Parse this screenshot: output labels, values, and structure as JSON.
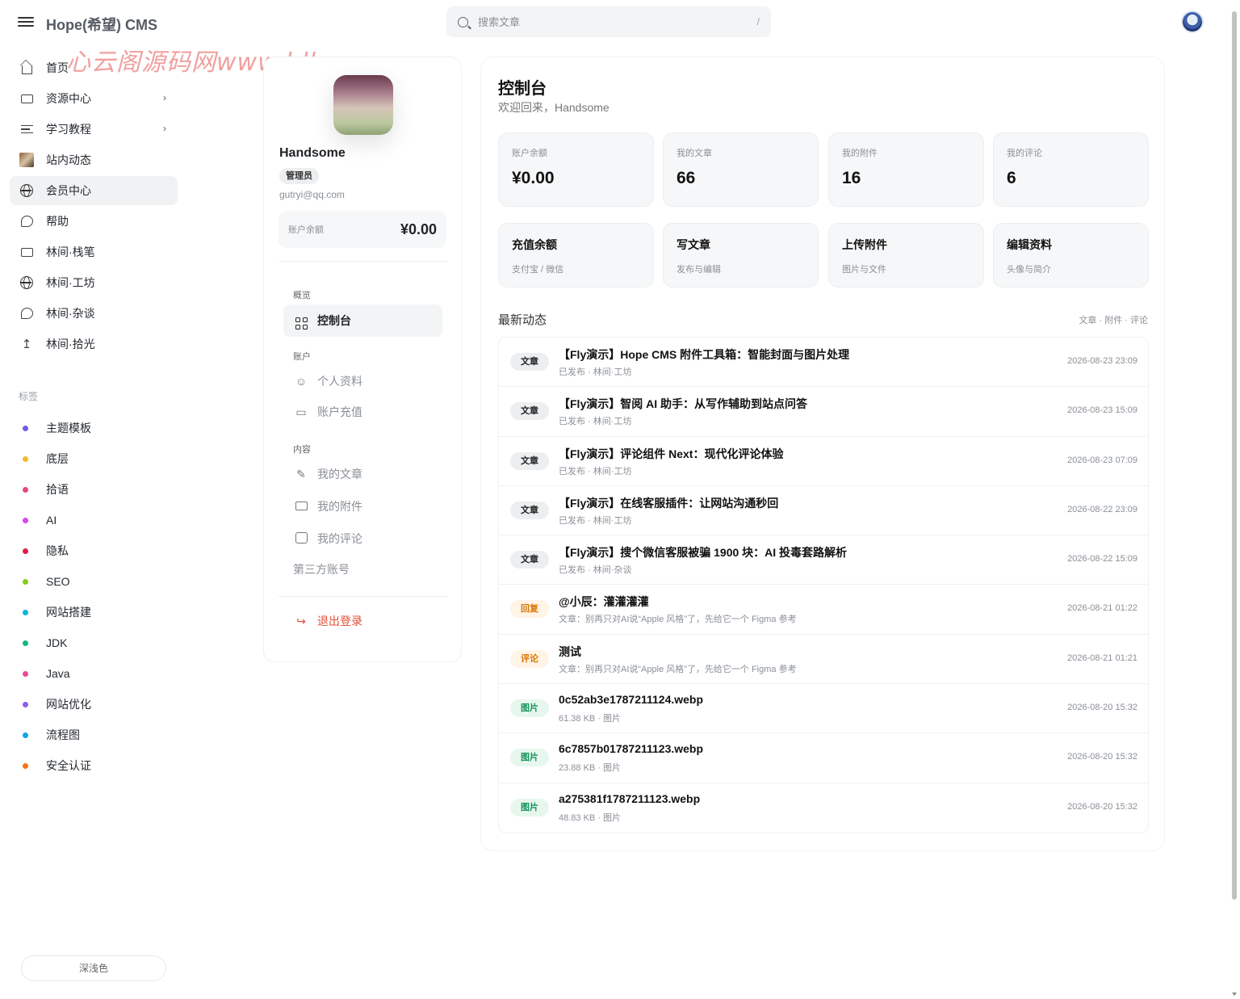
{
  "header": {
    "brand": "Hope(希望) CMS",
    "search_placeholder": "搜索文章",
    "search_shortcut": "/",
    "watermark": "心云阁源码网www.bllo.cn"
  },
  "nav": {
    "items": [
      {
        "label": "首页",
        "icon": "home-icon"
      },
      {
        "label": "资源中心",
        "icon": "folder-icon",
        "has_children": true
      },
      {
        "label": "学习教程",
        "icon": "list-icon",
        "has_children": true
      },
      {
        "label": "站内动态",
        "icon": "thumbnail-icon"
      },
      {
        "label": "会员中心",
        "icon": "globe-icon",
        "active": true
      },
      {
        "label": "帮助",
        "icon": "chat-icon"
      },
      {
        "label": "林间·栈笔",
        "icon": "folder-icon"
      },
      {
        "label": "林间·工坊",
        "icon": "globe-icon"
      },
      {
        "label": "林间·杂谈",
        "icon": "chat-icon"
      },
      {
        "label": "林间·拾光",
        "icon": "upload-icon"
      }
    ]
  },
  "tags": {
    "label": "标签",
    "items": [
      {
        "label": "主题模板",
        "color": "#6c5ce7"
      },
      {
        "label": "底层",
        "color": "#f5b82e"
      },
      {
        "label": "拾语",
        "color": "#e8467c"
      },
      {
        "label": "AI",
        "color": "#d946ef"
      },
      {
        "label": "隐私",
        "color": "#e11d48"
      },
      {
        "label": "SEO",
        "color": "#84cc16"
      },
      {
        "label": "网站搭建",
        "color": "#06b6d4"
      },
      {
        "label": "JDK",
        "color": "#10b981"
      },
      {
        "label": "Java",
        "color": "#ec4899"
      },
      {
        "label": "网站优化",
        "color": "#8b5cf6"
      },
      {
        "label": "流程图",
        "color": "#0ea5e9"
      },
      {
        "label": "安全认证",
        "color": "#f97316"
      }
    ]
  },
  "theme_toggle": "深浅色",
  "profile": {
    "name": "Handsome",
    "role": "管理员",
    "email": "gutryi@qq.com",
    "balance_label": "账户余额",
    "balance_value": "¥0.00",
    "sections": {
      "overview": "概览",
      "account": "账户",
      "content": "内容"
    },
    "menu": {
      "dashboard": "控制台",
      "profile": "个人资料",
      "recharge": "账户充值",
      "articles": "我的文章",
      "attachments": "我的附件",
      "comments": "我的评论",
      "third_party": "第三方账号",
      "logout": "退出登录"
    }
  },
  "dashboard": {
    "title": "控制台",
    "welcome": "欢迎回来，Handsome",
    "stats": [
      {
        "label": "账户余额",
        "value": "¥0.00"
      },
      {
        "label": "我的文章",
        "value": "66"
      },
      {
        "label": "我的附件",
        "value": "16"
      },
      {
        "label": "我的评论",
        "value": "6"
      }
    ],
    "actions": [
      {
        "title": "充值余额",
        "sub": "支付宝 / 微信"
      },
      {
        "title": "写文章",
        "sub": "发布与编辑"
      },
      {
        "title": "上传附件",
        "sub": "图片与文件"
      },
      {
        "title": "编辑资料",
        "sub": "头像与简介"
      }
    ],
    "feed_title": "最新动态",
    "feed_filter": "文章 · 附件 · 评论",
    "feed": [
      {
        "type": "article",
        "badge": "文章",
        "title": "【Fly演示】Hope CMS 附件工具箱：智能封面与图片处理",
        "sub": "已发布 · 林间·工坊",
        "date": "2026-08-23 23:09"
      },
      {
        "type": "article",
        "badge": "文章",
        "title": "【Fly演示】智阅 AI 助手：从写作辅助到站点问答",
        "sub": "已发布 · 林间·工坊",
        "date": "2026-08-23 15:09"
      },
      {
        "type": "article",
        "badge": "文章",
        "title": "【Fly演示】评论组件 Next：现代化评论体验",
        "sub": "已发布 · 林间·工坊",
        "date": "2026-08-23 07:09"
      },
      {
        "type": "article",
        "badge": "文章",
        "title": "【Fly演示】在线客服插件：让网站沟通秒回",
        "sub": "已发布 · 林间·工坊",
        "date": "2026-08-22 23:09"
      },
      {
        "type": "article",
        "badge": "文章",
        "title": "【Fly演示】搜个微信客服被骗 1900 块：AI 投毒套路解析",
        "sub": "已发布 · 林间·杂谈",
        "date": "2026-08-22 15:09"
      },
      {
        "type": "reply",
        "badge": "回复",
        "title": "@小辰：灌灌灌灌",
        "sub": "文章：别再只对AI说“Apple 风格”了，先给它一个 Figma 参考",
        "date": "2026-08-21 01:22"
      },
      {
        "type": "comment",
        "badge": "评论",
        "title": "测试",
        "sub": "文章：别再只对AI说“Apple 风格”了，先给它一个 Figma 参考",
        "date": "2026-08-21 01:21"
      },
      {
        "type": "image",
        "badge": "图片",
        "title": "0c52ab3e1787211124.webp",
        "sub": "61.38 KB · 图片",
        "date": "2026-08-20 15:32"
      },
      {
        "type": "image",
        "badge": "图片",
        "title": "6c7857b01787211123.webp",
        "sub": "23.88 KB · 图片",
        "date": "2026-08-20 15:32"
      },
      {
        "type": "image",
        "badge": "图片",
        "title": "a275381f1787211123.webp",
        "sub": "48.83 KB · 图片",
        "date": "2026-08-20 15:32"
      }
    ]
  }
}
